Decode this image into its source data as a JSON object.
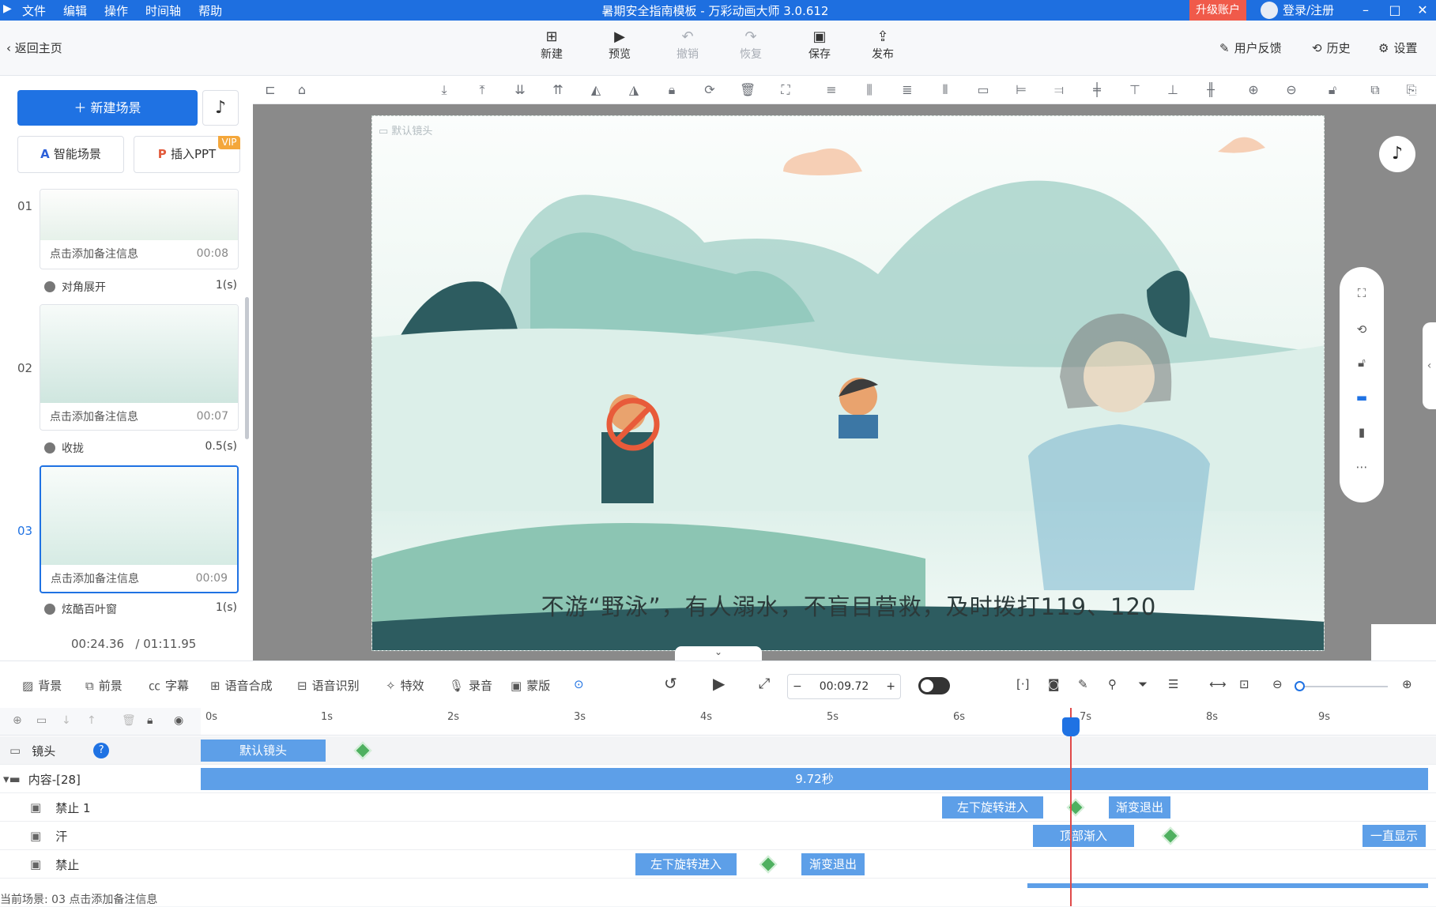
{
  "titlebar": {
    "menu": [
      "文件",
      "编辑",
      "操作",
      "时间轴",
      "帮助"
    ],
    "title": "暑期安全指南模板 - 万彩动画大师 3.0.612",
    "upgrade": "升级账户",
    "login": "登录/注册"
  },
  "toolbar": {
    "back": "返回主页",
    "buttons": [
      "新建",
      "预览",
      "撤销",
      "恢复",
      "保存",
      "发布"
    ],
    "right": [
      "用户反馈",
      "历史",
      "设置"
    ]
  },
  "left": {
    "new_scene": "新建场景",
    "smart": "智能场景",
    "ppt": "插入PPT",
    "vip": "VIP",
    "scenes": [
      {
        "num": "01",
        "note": "点击添加备注信息",
        "time": "00:08",
        "trans": "对角展开",
        "tdur": "1(s)"
      },
      {
        "num": "02",
        "note": "点击添加备注信息",
        "time": "00:07",
        "trans": "收拢",
        "tdur": "0.5(s)"
      },
      {
        "num": "03",
        "note": "点击添加备注信息",
        "time": "00:09",
        "trans": "炫酷百叶窗",
        "tdur": "1(s)"
      }
    ],
    "current_time": "00:24.36",
    "total_time": "/ 01:11.95"
  },
  "stage": {
    "camera_label": "默认镜头",
    "caption": "不游“野泳”，有人溺水，不盲目营救，及时拨打119、120"
  },
  "timeline_tools": [
    "背景",
    "前景",
    "字幕",
    "语音合成",
    "语音识别",
    "特效",
    "录音",
    "蒙版"
  ],
  "playback": {
    "time": "00:09.72",
    "minus": "−",
    "plus": "+"
  },
  "timeline": {
    "ticks": [
      "0s",
      "1s",
      "2s",
      "3s",
      "4s",
      "5s",
      "6s",
      "7s",
      "8s",
      "9s"
    ],
    "rows": [
      {
        "name": "镜头",
        "segs": [
          {
            "label": "默认镜头"
          }
        ]
      },
      {
        "name": "内容-[28]",
        "segs": [
          {
            "label": "9.72秒"
          }
        ]
      },
      {
        "name": "禁止 1",
        "segs": [
          {
            "label": "左下旋转进入"
          },
          {
            "label": "渐变退出"
          }
        ]
      },
      {
        "name": "汗",
        "segs": [
          {
            "label": "顶部渐入"
          },
          {
            "label": "一直显示"
          }
        ]
      },
      {
        "name": "禁止",
        "segs": [
          {
            "label": "左下旋转进入"
          },
          {
            "label": "渐变退出"
          }
        ]
      }
    ],
    "status": "当前场景: 03   点击添加备注信息"
  }
}
